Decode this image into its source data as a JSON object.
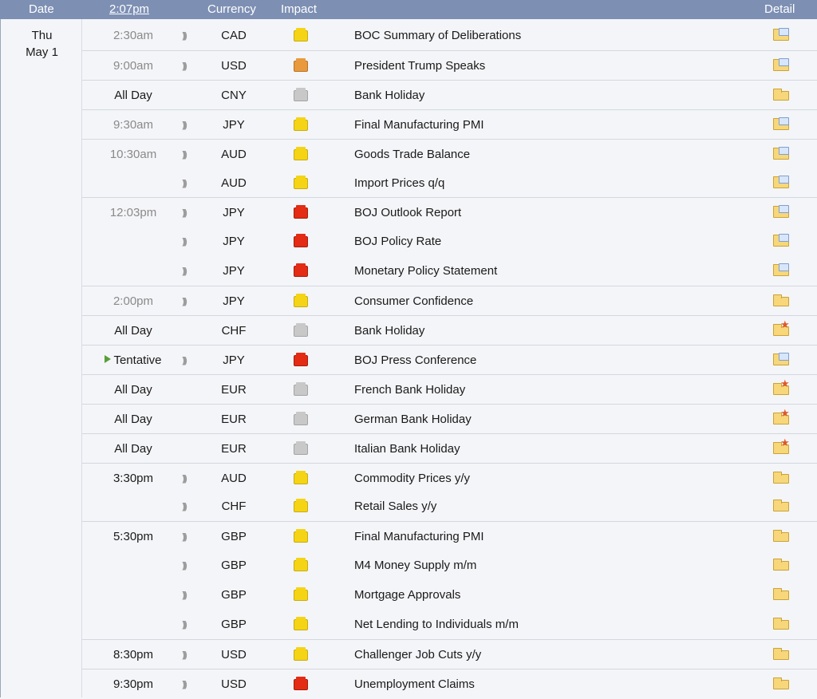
{
  "header": {
    "date": "Date",
    "time": "2:07pm",
    "currency": "Currency",
    "impact": "Impact",
    "detail": "Detail"
  },
  "day": {
    "weekday": "Thu",
    "date": "May 1"
  },
  "impact_colors": {
    "high": "#e42b14",
    "medium": "#e89a3c",
    "low": "#f5d415",
    "holiday": "#c8c8c8"
  },
  "rows": [
    {
      "time": "2:30am",
      "currency": "CAD",
      "impact": "low",
      "title": "BOC Summary of Deliberations",
      "detail": "doc",
      "sep": false,
      "muted": true,
      "sound": true
    },
    {
      "time": "9:00am",
      "currency": "USD",
      "impact": "medium",
      "title": "President Trump Speaks",
      "detail": "doc",
      "sep": true,
      "muted": true,
      "sound": true
    },
    {
      "time": "All Day",
      "currency": "CNY",
      "impact": "holiday",
      "title": "Bank Holiday",
      "detail": "folder",
      "sep": true,
      "muted": false,
      "sound": false
    },
    {
      "time": "9:30am",
      "currency": "JPY",
      "impact": "low",
      "title": "Final Manufacturing PMI",
      "detail": "doc",
      "sep": true,
      "muted": true,
      "sound": true
    },
    {
      "time": "10:30am",
      "currency": "AUD",
      "impact": "low",
      "title": "Goods Trade Balance",
      "detail": "doc",
      "sep": true,
      "muted": true,
      "sound": true
    },
    {
      "time": "",
      "currency": "AUD",
      "impact": "low",
      "title": "Import Prices q/q",
      "detail": "doc",
      "sep": false,
      "muted": true,
      "sound": true
    },
    {
      "time": "12:03pm",
      "currency": "JPY",
      "impact": "high",
      "title": "BOJ Outlook Report",
      "detail": "doc",
      "sep": true,
      "muted": true,
      "sound": true
    },
    {
      "time": "",
      "currency": "JPY",
      "impact": "high",
      "title": "BOJ Policy Rate",
      "detail": "doc",
      "sep": false,
      "muted": true,
      "sound": true
    },
    {
      "time": "",
      "currency": "JPY",
      "impact": "high",
      "title": "Monetary Policy Statement",
      "detail": "doc",
      "sep": false,
      "muted": true,
      "sound": true
    },
    {
      "time": "2:00pm",
      "currency": "JPY",
      "impact": "low",
      "title": "Consumer Confidence",
      "detail": "folder",
      "sep": true,
      "muted": true,
      "sound": true
    },
    {
      "time": "All Day",
      "currency": "CHF",
      "impact": "holiday",
      "title": "Bank Holiday",
      "detail": "star",
      "sep": true,
      "muted": false,
      "sound": false
    },
    {
      "time": "Tentative",
      "currency": "JPY",
      "impact": "high",
      "title": "BOJ Press Conference",
      "detail": "doc",
      "sep": true,
      "muted": false,
      "sound": true,
      "tentative": true
    },
    {
      "time": "All Day",
      "currency": "EUR",
      "impact": "holiday",
      "title": "French Bank Holiday",
      "detail": "star",
      "sep": true,
      "muted": false,
      "sound": false
    },
    {
      "time": "All Day",
      "currency": "EUR",
      "impact": "holiday",
      "title": "German Bank Holiday",
      "detail": "star",
      "sep": true,
      "muted": false,
      "sound": false
    },
    {
      "time": "All Day",
      "currency": "EUR",
      "impact": "holiday",
      "title": "Italian Bank Holiday",
      "detail": "star",
      "sep": true,
      "muted": false,
      "sound": false
    },
    {
      "time": "3:30pm",
      "currency": "AUD",
      "impact": "low",
      "title": "Commodity Prices y/y",
      "detail": "folder",
      "sep": true,
      "muted": false,
      "sound": true
    },
    {
      "time": "",
      "currency": "CHF",
      "impact": "low",
      "title": "Retail Sales y/y",
      "detail": "folder",
      "sep": false,
      "muted": false,
      "sound": true
    },
    {
      "time": "5:30pm",
      "currency": "GBP",
      "impact": "low",
      "title": "Final Manufacturing PMI",
      "detail": "folder",
      "sep": true,
      "muted": false,
      "sound": true
    },
    {
      "time": "",
      "currency": "GBP",
      "impact": "low",
      "title": "M4 Money Supply m/m",
      "detail": "folder",
      "sep": false,
      "muted": false,
      "sound": true
    },
    {
      "time": "",
      "currency": "GBP",
      "impact": "low",
      "title": "Mortgage Approvals",
      "detail": "folder",
      "sep": false,
      "muted": false,
      "sound": true
    },
    {
      "time": "",
      "currency": "GBP",
      "impact": "low",
      "title": "Net Lending to Individuals m/m",
      "detail": "folder",
      "sep": false,
      "muted": false,
      "sound": true
    },
    {
      "time": "8:30pm",
      "currency": "USD",
      "impact": "low",
      "title": "Challenger Job Cuts y/y",
      "detail": "folder",
      "sep": true,
      "muted": false,
      "sound": true
    },
    {
      "time": "9:30pm",
      "currency": "USD",
      "impact": "high",
      "title": "Unemployment Claims",
      "detail": "folder",
      "sep": true,
      "muted": false,
      "sound": true
    }
  ]
}
